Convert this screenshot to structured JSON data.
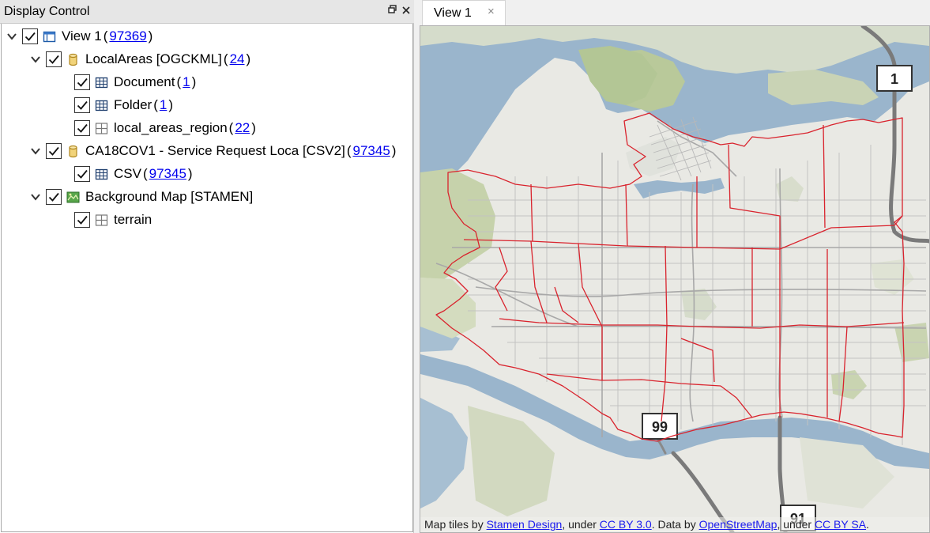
{
  "panel": {
    "title": "Display Control"
  },
  "tree": {
    "view": {
      "label": "View 1",
      "count": "97369"
    },
    "local_areas": {
      "label": "LocalAreas [OGCKML]",
      "count": "24"
    },
    "document": {
      "label": "Document",
      "count": "1"
    },
    "folder": {
      "label": "Folder",
      "count": "1"
    },
    "region": {
      "label": "local_areas_region",
      "count": "22"
    },
    "service": {
      "label": "CA18COV1 - Service Request Loca [CSV2]",
      "count": "97345"
    },
    "csv": {
      "label": "CSV",
      "count": "97345"
    },
    "background": {
      "label": "Background Map [STAMEN]"
    },
    "terrain": {
      "label": "terrain"
    }
  },
  "tabs": {
    "view1": {
      "label": "View 1",
      "close": "×"
    }
  },
  "map": {
    "shields": {
      "hwy1": "1",
      "hwy99": "99",
      "hwy91": "91"
    },
    "attribution": {
      "prefix": "Map tiles by ",
      "stamen": "Stamen Design",
      "under1": ", under ",
      "ccby": "CC BY 3.0",
      "data_by": ". Data by ",
      "osm": "OpenStreetMap",
      "under2": ", under ",
      "ccbysa": "CC BY SA",
      "suffix": "."
    },
    "colors": {
      "water": "#9ab5cc",
      "land": "#e9e9e4",
      "park": "#b9c99a",
      "boundary": "#d9232d",
      "road": "#b4b4b4",
      "highway": "#7a7a7a"
    }
  },
  "icons": {
    "expand": "chevron-down-icon",
    "checked": "checkbox-checked",
    "view": "view-window-icon",
    "database": "database-cylinder-icon",
    "table": "table-grid-icon",
    "region": "region-grid-icon",
    "background": "map-image-icon",
    "float": "float-window-icon",
    "close": "close-icon"
  }
}
